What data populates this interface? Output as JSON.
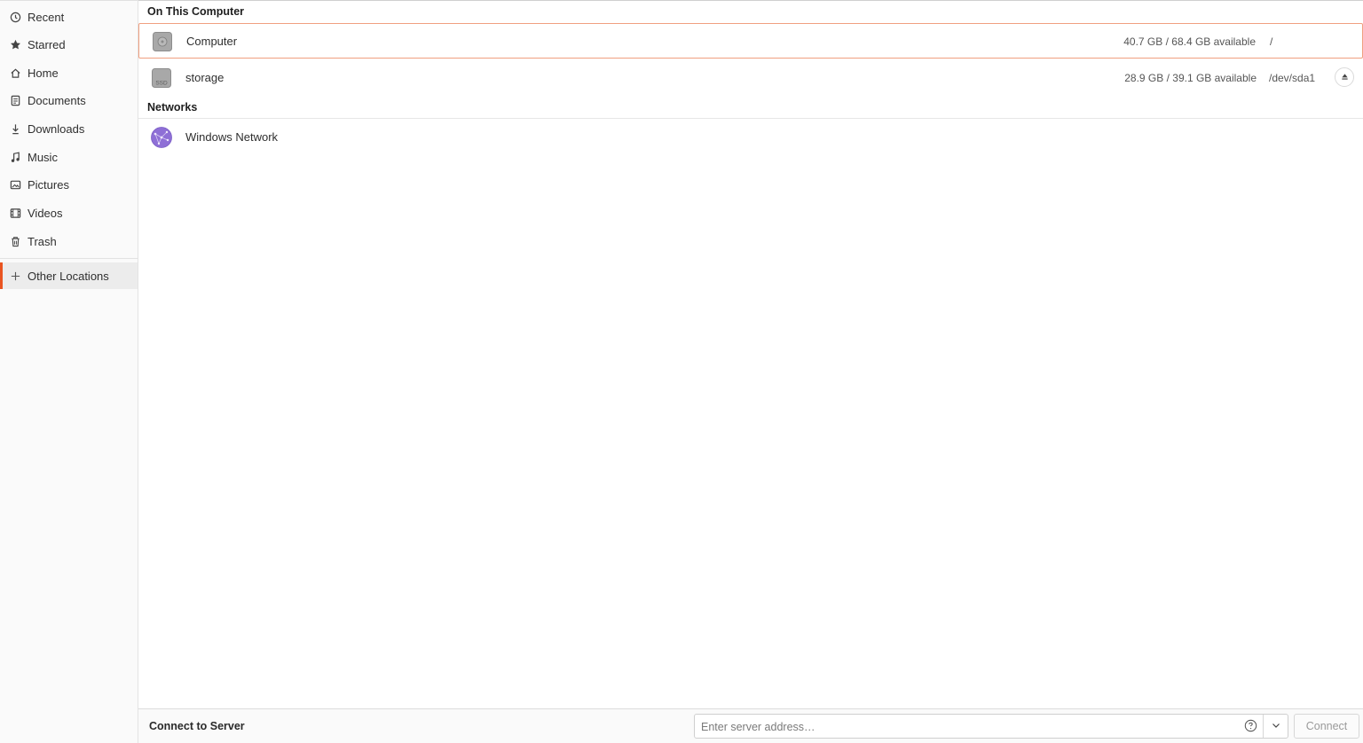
{
  "sidebar": {
    "items": [
      {
        "label": "Recent",
        "icon": "clock-icon"
      },
      {
        "label": "Starred",
        "icon": "star-icon"
      },
      {
        "label": "Home",
        "icon": "home-icon"
      },
      {
        "label": "Documents",
        "icon": "document-icon"
      },
      {
        "label": "Downloads",
        "icon": "download-icon"
      },
      {
        "label": "Music",
        "icon": "music-note-icon"
      },
      {
        "label": "Pictures",
        "icon": "picture-icon"
      },
      {
        "label": "Videos",
        "icon": "film-icon"
      },
      {
        "label": "Trash",
        "icon": "trash-icon"
      }
    ],
    "other_locations": {
      "label": "Other Locations",
      "icon": "plus-icon",
      "active": true
    }
  },
  "main": {
    "on_this_computer": {
      "title": "On This Computer",
      "rows": [
        {
          "name": "Computer",
          "size": "40.7 GB / 68.4 GB available",
          "path": "/",
          "icon": "hard-disk-icon",
          "selected": true
        },
        {
          "name": "storage",
          "size": "28.9 GB / 39.1 GB available",
          "path": "/dev/sda1",
          "icon": "ssd-icon",
          "icon_text": "SSD",
          "eject": true
        }
      ]
    },
    "networks": {
      "title": "Networks",
      "rows": [
        {
          "name": "Windows Network",
          "icon": "network-globe-icon"
        }
      ]
    }
  },
  "bottombar": {
    "label": "Connect to Server",
    "input_placeholder": "Enter server address…",
    "connect_label": "Connect"
  },
  "colors": {
    "accent": "#e95420",
    "network_icon": "#8e6fd6"
  }
}
